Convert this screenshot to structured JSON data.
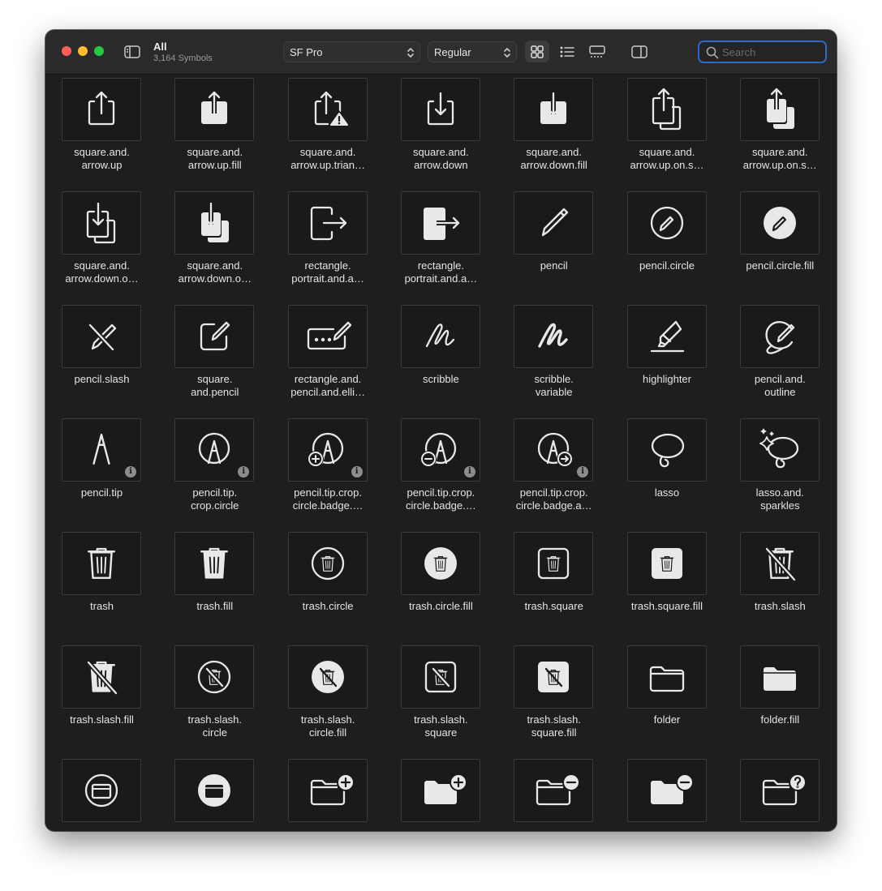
{
  "window": {
    "title": "All",
    "subtitle": "3,164 Symbols"
  },
  "toolbar": {
    "font_popup": "SF Pro",
    "weight_popup": "Regular",
    "view_modes": [
      "grid-view-icon",
      "list-view-icon",
      "gallery-view-icon"
    ],
    "active_view": "grid"
  },
  "search": {
    "placeholder": "Search",
    "value": ""
  },
  "colors": {
    "window_bg": "#1e1e1e",
    "titlebar_bg": "#2a2a2a",
    "tile_border": "#3a3a3a",
    "glyph": "#e8e8e8",
    "search_focus": "#2c69c8"
  },
  "symbols": [
    {
      "name": "square.and.\narrow.up",
      "icon": "share-up-icon"
    },
    {
      "name": "square.and.\narrow.up.fill",
      "icon": "share-up-fill-icon"
    },
    {
      "name": "square.and.\narrow.up.trian…",
      "icon": "share-up-triangle-icon"
    },
    {
      "name": "square.and.\narrow.down",
      "icon": "share-down-icon"
    },
    {
      "name": "square.and.\narrow.down.fill",
      "icon": "share-down-fill-icon"
    },
    {
      "name": "square.and.\narrow.up.on.s…",
      "icon": "share-up-on-square-icon"
    },
    {
      "name": "square.and.\narrow.up.on.s…",
      "icon": "share-up-on-square-fill-icon"
    },
    {
      "name": "square.and.\narrow.down.o…",
      "icon": "share-down-on-square-icon"
    },
    {
      "name": "square.and.\narrow.down.o…",
      "icon": "share-down-on-square-fill-icon"
    },
    {
      "name": "rectangle.\nportrait.and.a…",
      "icon": "portrait-arrow-right-icon"
    },
    {
      "name": "rectangle.\nportrait.and.a…",
      "icon": "portrait-arrow-right-fill-icon"
    },
    {
      "name": "pencil",
      "icon": "pencil-icon"
    },
    {
      "name": "pencil.circle",
      "icon": "pencil-circle-icon"
    },
    {
      "name": "pencil.circle.fill",
      "icon": "pencil-circle-fill-icon"
    },
    {
      "name": "pencil.slash",
      "icon": "pencil-slash-icon"
    },
    {
      "name": "square.\nand.pencil",
      "icon": "square-and-pencil-icon"
    },
    {
      "name": "rectangle.and.\npencil.and.elli…",
      "icon": "rectangle-pencil-ellipsis-icon"
    },
    {
      "name": "scribble",
      "icon": "scribble-icon"
    },
    {
      "name": "scribble.\nvariable",
      "icon": "scribble-variable-icon"
    },
    {
      "name": "highlighter",
      "icon": "highlighter-icon"
    },
    {
      "name": "pencil.and.\noutline",
      "icon": "pencil-and-outline-icon"
    },
    {
      "name": "pencil.tip",
      "icon": "pencil-tip-icon",
      "info": true
    },
    {
      "name": "pencil.tip.\ncrop.circle",
      "icon": "pencil-tip-crop-circle-icon",
      "info": true
    },
    {
      "name": "pencil.tip.crop.\ncircle.badge.…",
      "icon": "pencil-tip-badge-plus-icon",
      "info": true
    },
    {
      "name": "pencil.tip.crop.\ncircle.badge.…",
      "icon": "pencil-tip-badge-minus-icon",
      "info": true
    },
    {
      "name": "pencil.tip.crop.\ncircle.badge.a…",
      "icon": "pencil-tip-badge-arrow-icon",
      "info": true
    },
    {
      "name": "lasso",
      "icon": "lasso-icon"
    },
    {
      "name": "lasso.and.\nsparkles",
      "icon": "lasso-sparkles-icon"
    },
    {
      "name": "trash",
      "icon": "trash-icon"
    },
    {
      "name": "trash.fill",
      "icon": "trash-fill-icon"
    },
    {
      "name": "trash.circle",
      "icon": "trash-circle-icon"
    },
    {
      "name": "trash.circle.fill",
      "icon": "trash-circle-fill-icon"
    },
    {
      "name": "trash.square",
      "icon": "trash-square-icon"
    },
    {
      "name": "trash.square.fill",
      "icon": "trash-square-fill-icon"
    },
    {
      "name": "trash.slash",
      "icon": "trash-slash-icon"
    },
    {
      "name": "trash.slash.fill",
      "icon": "trash-slash-fill-icon"
    },
    {
      "name": "trash.slash.\ncircle",
      "icon": "trash-slash-circle-icon"
    },
    {
      "name": "trash.slash.\ncircle.fill",
      "icon": "trash-slash-circle-fill-icon"
    },
    {
      "name": "trash.slash.\nsquare",
      "icon": "trash-slash-square-icon"
    },
    {
      "name": "trash.slash.\nsquare.fill",
      "icon": "trash-slash-square-fill-icon"
    },
    {
      "name": "folder",
      "icon": "folder-icon"
    },
    {
      "name": "folder.fill",
      "icon": "folder-fill-icon"
    },
    {
      "name": "",
      "icon": "tray-circle-icon"
    },
    {
      "name": "",
      "icon": "tray-circle-fill-icon"
    },
    {
      "name": "",
      "icon": "folder-badge-plus-icon"
    },
    {
      "name": "",
      "icon": "folder-fill-badge-plus-icon"
    },
    {
      "name": "",
      "icon": "folder-badge-minus-icon"
    },
    {
      "name": "",
      "icon": "folder-fill-badge-minus-icon"
    },
    {
      "name": "",
      "icon": "folder-badge-questionmark-icon"
    }
  ]
}
